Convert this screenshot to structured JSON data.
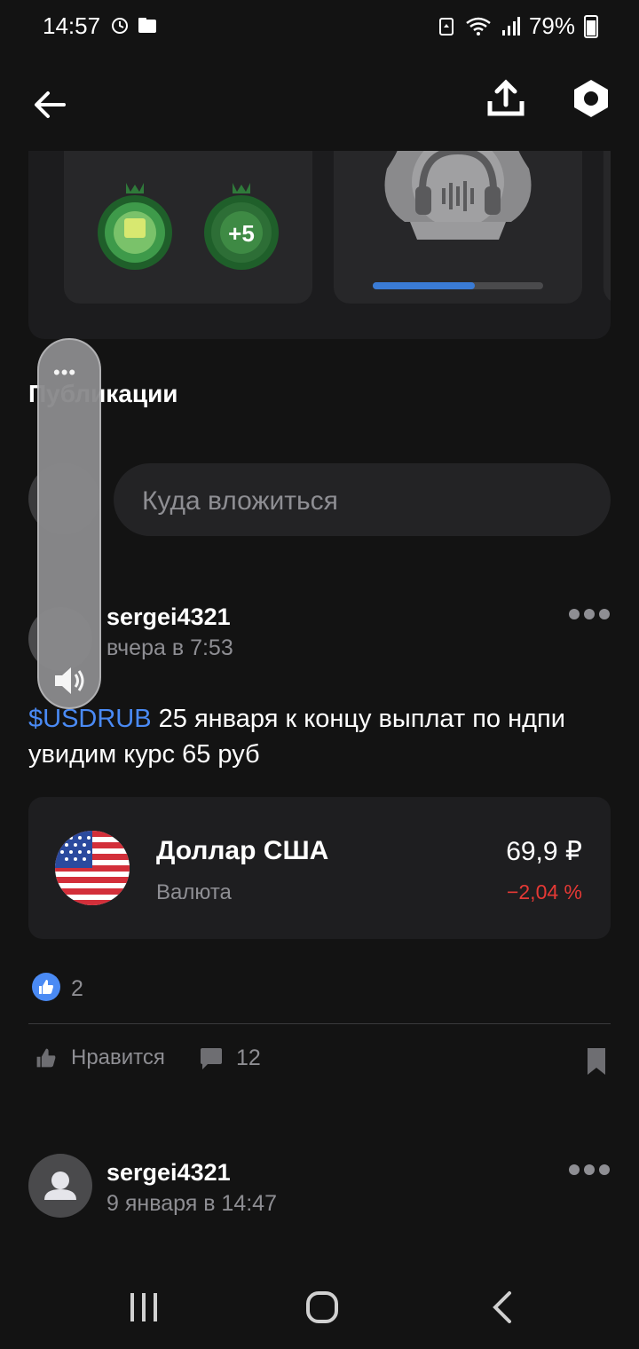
{
  "status": {
    "time": "14:57",
    "battery": "79%"
  },
  "appbar": {
    "back_icon": "arrow-left-icon",
    "share_icon": "share-upload-icon",
    "settings_icon": "settings-hexagon-icon"
  },
  "achievements": {
    "more_badge": "+5",
    "progress": 0.6
  },
  "publications": {
    "title": "Публикации",
    "composer_placeholder": "Куда вложиться"
  },
  "volume_overlay": {
    "more": "•••"
  },
  "post": {
    "author": "sergei4321",
    "time": "вчера в 7:53",
    "ticker": "$USDRUB",
    "text": " 25 января к концу выплат по ндпи увидим курс 65 руб",
    "instrument": {
      "name": "Доллар США",
      "type": "Валюта",
      "price": "69,9 ₽",
      "change": "−2,04 %"
    },
    "likes_count": "2",
    "like_label": "Нравится",
    "comments_count": "12"
  },
  "post2": {
    "author": "sergei4321",
    "time": "9 января в 14:47"
  },
  "colors": {
    "background": "#131313",
    "accent": "#4a8af4",
    "negative": "#e53935"
  }
}
